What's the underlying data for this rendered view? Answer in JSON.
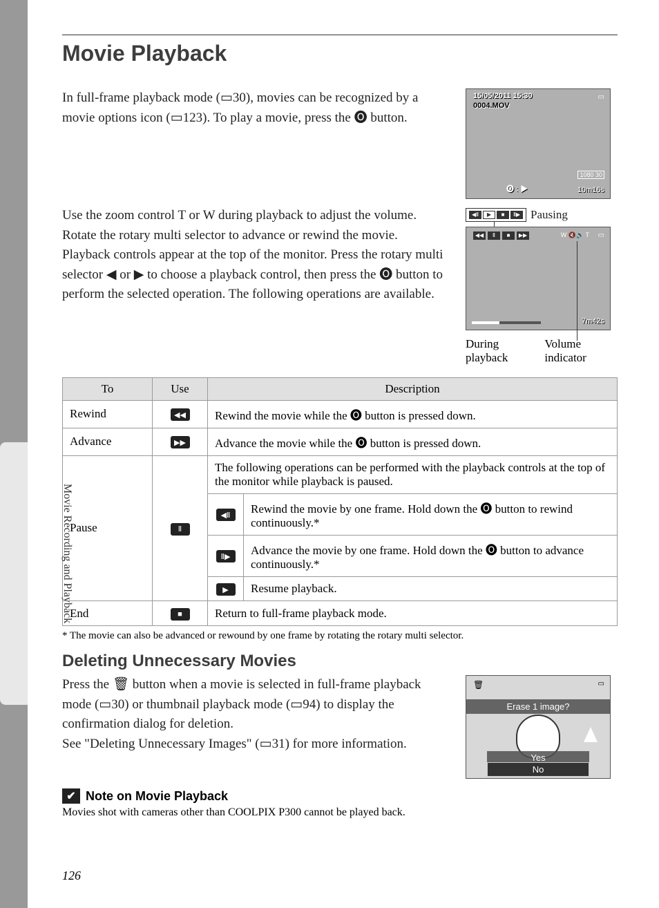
{
  "sidebar_label": "Movie Recording and Playback",
  "page_number": "126",
  "h1": "Movie Playback",
  "intro": "In full-frame playback mode (▭30), movies can be recognized by a movie options icon (▭123). To play a movie, press the 🅞 button.",
  "para2": "Use the zoom control T or W during playback to adjust the volume.",
  "para3": "Rotate the rotary multi selector to advance or rewind the movie.",
  "para4": "Playback controls appear at the top of the monitor. Press the rotary multi selector ◀ or ▶ to choose a playback control, then press the 🅞 button to perform the selected operation. The following operations are available.",
  "screen1": {
    "datetime": "15/05/2011 15:30",
    "filename": "0004.MOV",
    "quality": "1080 30",
    "time": "10m16s",
    "okplay": "🅞 : ▶"
  },
  "pausing_label": "Pausing",
  "screen2": {
    "wt": "W 🔇🔊 T",
    "time": "7m42s"
  },
  "label_during": "During playback",
  "label_volume": "Volume indicator",
  "table": {
    "headers": {
      "to": "To",
      "use": "Use",
      "desc": "Description"
    },
    "rewind": {
      "label": "Rewind",
      "desc": "Rewind the movie while the 🅞 button is pressed down."
    },
    "advance": {
      "label": "Advance",
      "desc": "Advance the movie while the 🅞 button is pressed down."
    },
    "pause": {
      "label": "Pause",
      "intro": "The following operations can be performed with the playback controls at the top of the monitor while playback is paused.",
      "frame_back": "Rewind the movie by one frame. Hold down the 🅞 button to rewind continuously.*",
      "frame_fwd": "Advance the movie by one frame. Hold down the 🅞 button to advance continuously.*",
      "resume": "Resume playback."
    },
    "end": {
      "label": "End",
      "desc": "Return to full-frame playback mode."
    }
  },
  "footnote": "*   The movie can also be advanced or rewound by one frame by rotating the rotary multi selector.",
  "h2": "Deleting Unnecessary Movies",
  "delete_text1": "Press the 🗑 button when a movie is selected in full-frame playback mode (▭30) or thumbnail playback mode (▭94) to display the confirmation dialog for deletion.",
  "delete_text2": "See \"Deleting Unnecessary Images\" (▭31) for more information.",
  "erase": {
    "prompt": "Erase 1 image?",
    "yes": "Yes",
    "no": "No"
  },
  "note": {
    "title": "Note on Movie Playback",
    "text": "Movies shot with cameras other than COOLPIX P300 cannot be played back."
  }
}
